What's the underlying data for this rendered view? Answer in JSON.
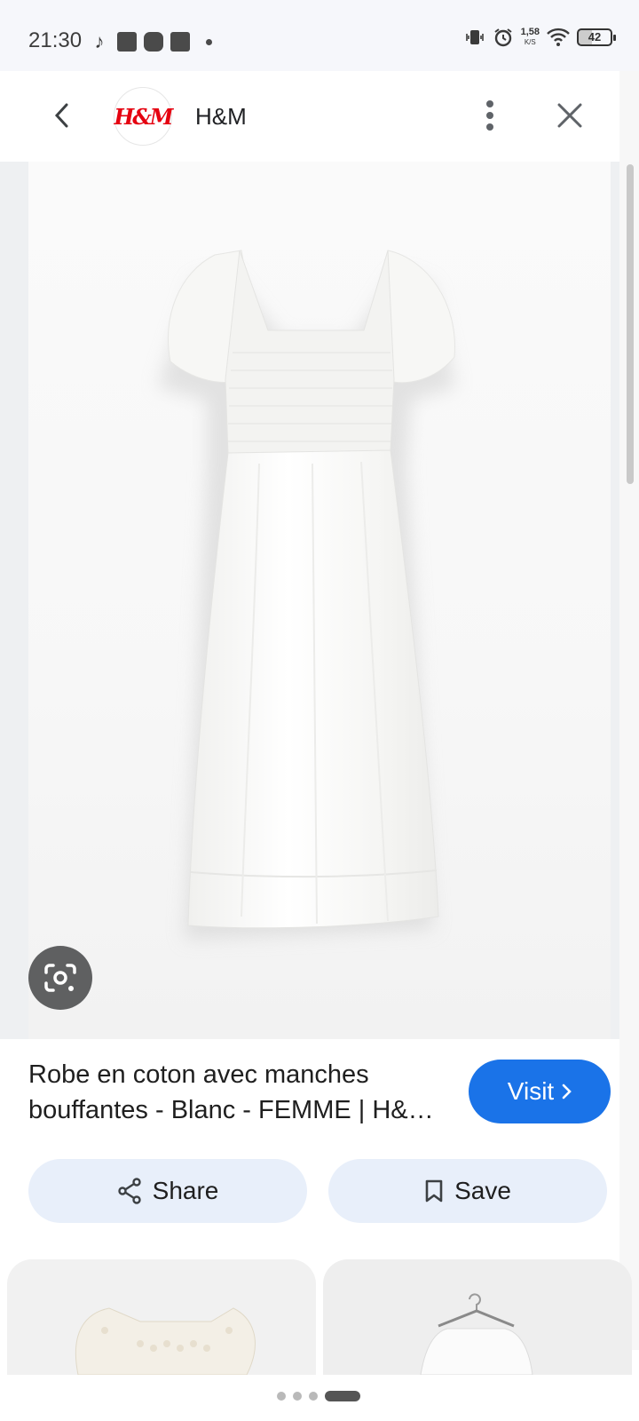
{
  "status_bar": {
    "time": "21:30",
    "net_speed_value": "1,58",
    "net_speed_unit": "K/S",
    "battery": "42",
    "icons": [
      "tiktok-icon",
      "notification-icon",
      "notification-icon",
      "notification-icon",
      "vibrate-icon",
      "alarm-icon",
      "wifi-icon",
      "battery-icon"
    ]
  },
  "header": {
    "logo_text": "H&M",
    "site_name": "H&M",
    "back_icon": "chevron-left-icon",
    "more_icon": "more-vert-icon",
    "close_icon": "close-icon"
  },
  "product": {
    "title": "Robe en coton avec manches bouffantes - Blanc - FEMME | H&M FR",
    "visit_label": "Visit",
    "image_description_icon": "lens-icon"
  },
  "actions": {
    "share_label": "Share",
    "save_label": "Save"
  },
  "colors": {
    "accent": "#1a73e8",
    "action_bg": "#e8effa",
    "brand_red": "#e50010"
  }
}
